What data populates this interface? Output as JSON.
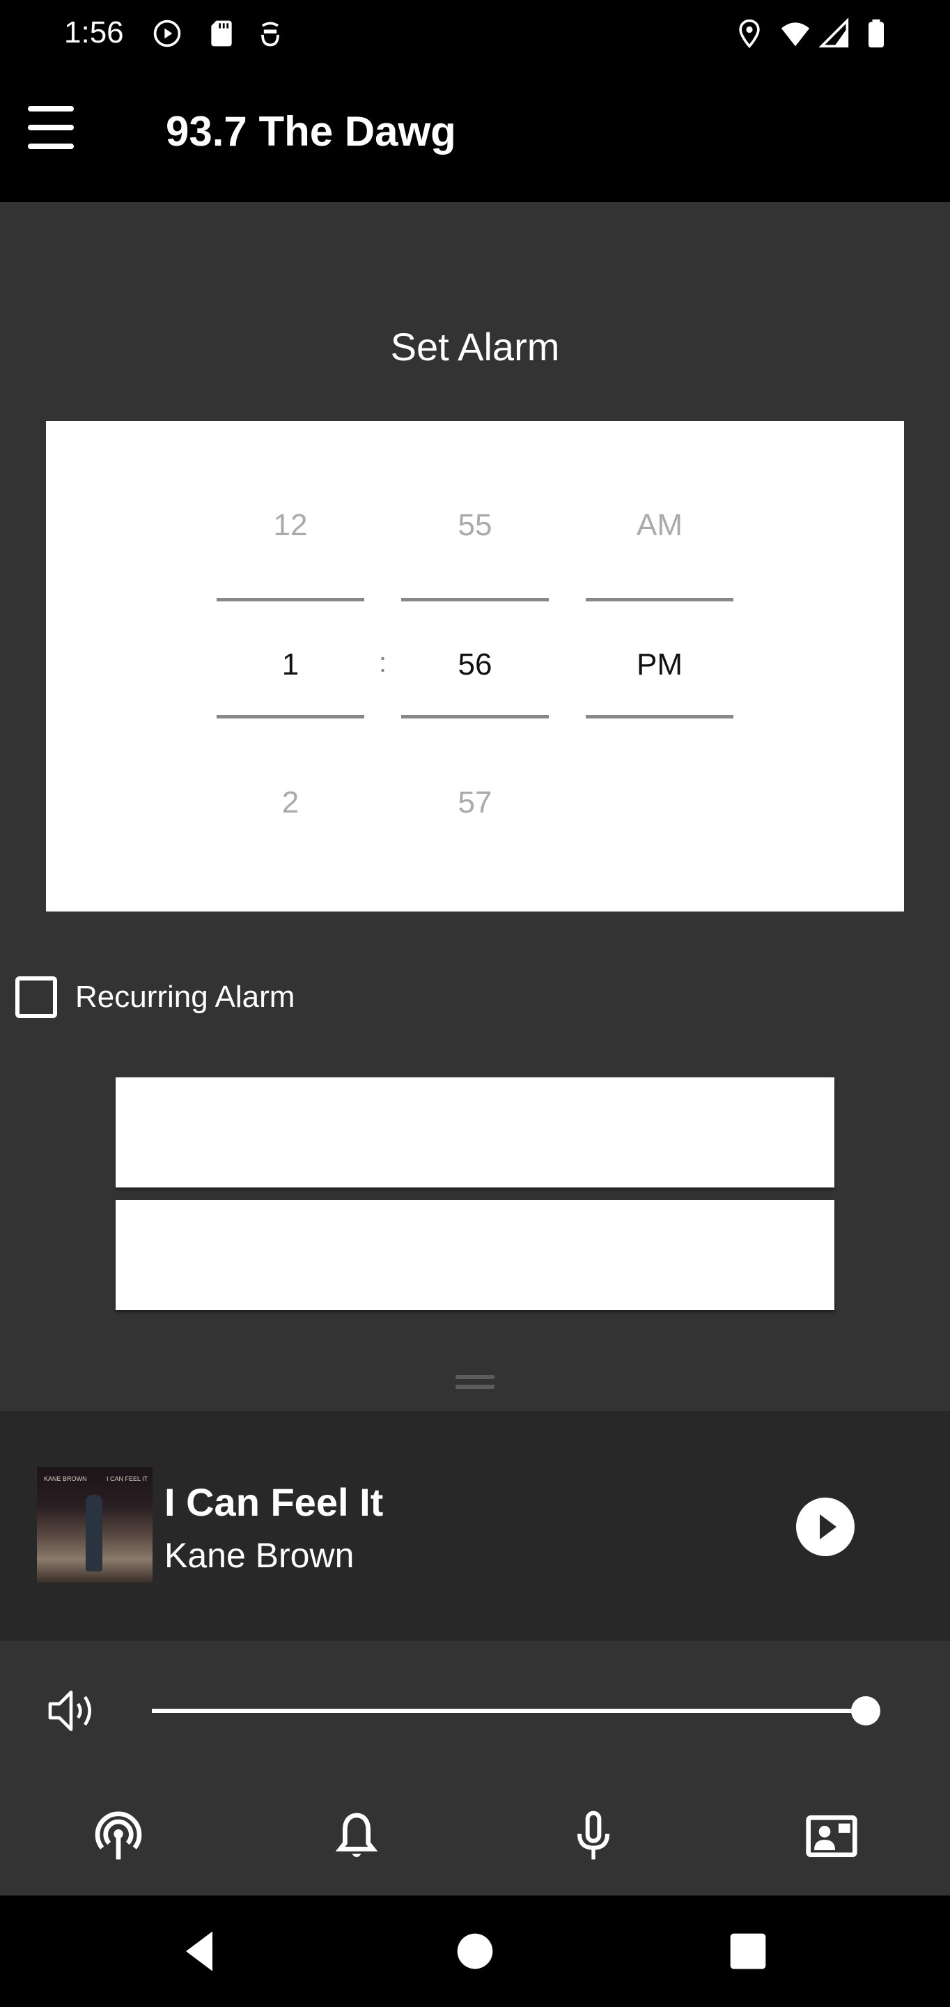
{
  "status_bar": {
    "time": "1:56",
    "left_icons": [
      "play-circle-icon",
      "sd-card-icon",
      "accessibility-icon"
    ],
    "right_icons": [
      "location-icon",
      "wifi-icon",
      "signal-icon",
      "battery-icon"
    ]
  },
  "app_bar": {
    "menu_icon": "hamburger-menu-icon",
    "title": "93.7 The Dawg"
  },
  "alarm": {
    "title": "Set Alarm",
    "picker": {
      "hour": {
        "prev": "12",
        "selected": "1",
        "next": "2"
      },
      "separator": ":",
      "minute": {
        "prev": "55",
        "selected": "56",
        "next": "57"
      },
      "period": {
        "prev": "AM",
        "selected": "PM",
        "next": ""
      }
    },
    "recurring": {
      "label": "Recurring Alarm",
      "checked": false
    },
    "buttons": [
      {
        "label": ""
      },
      {
        "label": ""
      }
    ]
  },
  "now_playing": {
    "title": "I Can Feel It",
    "artist": "Kane Brown",
    "album_art_text_left": "KANE BROWN",
    "album_art_text_right": "I CAN FEEL IT",
    "play_icon": "play-icon"
  },
  "volume": {
    "icon": "volume-icon",
    "level_percent": 100
  },
  "bottom_tabs": [
    {
      "icon": "podcast-antenna-icon",
      "name": "tab-live"
    },
    {
      "icon": "bell-icon",
      "name": "tab-alarm"
    },
    {
      "icon": "microphone-icon",
      "name": "tab-voice"
    },
    {
      "icon": "contact-card-icon",
      "name": "tab-contact"
    }
  ],
  "system_nav": [
    "back-icon",
    "home-icon",
    "recents-icon"
  ],
  "colors": {
    "app_bar": "#000000",
    "content_bg": "#333333",
    "player_bg": "#282828",
    "picker_bg": "#ffffff",
    "picker_dim_text": "#aaaaaa",
    "picker_line": "#888888"
  }
}
